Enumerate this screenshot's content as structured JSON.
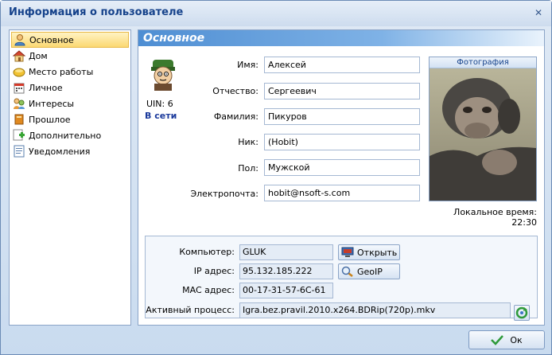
{
  "window": {
    "title": "Информация о пользователе",
    "close_glyph": "✕"
  },
  "sidebar": {
    "items": [
      {
        "label": "Основное",
        "icon": "user-icon",
        "active": true
      },
      {
        "label": "Дом",
        "icon": "home-icon"
      },
      {
        "label": "Место работы",
        "icon": "work-icon"
      },
      {
        "label": "Личное",
        "icon": "calendar-icon"
      },
      {
        "label": "Интересы",
        "icon": "interests-icon"
      },
      {
        "label": "Прошлое",
        "icon": "book-icon"
      },
      {
        "label": "Дополнительно",
        "icon": "plus-icon"
      },
      {
        "label": "Уведомления",
        "icon": "notes-icon"
      }
    ]
  },
  "main": {
    "header": "Основное",
    "uin_label": "UIN:",
    "uin_value": "6",
    "status": "В сети",
    "fields": [
      {
        "label": "Имя:",
        "value": "Алексей"
      },
      {
        "label": "Отчество:",
        "value": "Сергеевич"
      },
      {
        "label": "Фамилия:",
        "value": "Пикуров"
      },
      {
        "label": "Ник:",
        "value": "(Hobit)"
      },
      {
        "label": "Пол:",
        "value": "Мужской"
      },
      {
        "label": "Электропочта:",
        "value": "hobit@nsoft-s.com"
      }
    ],
    "photo_title": "Фотография",
    "local_time": "Локальное время: 22:30"
  },
  "network": {
    "computer_label": "Компьютер:",
    "computer_value": "GLUK",
    "open_button": "Открыть",
    "ip_label": "IP адрес:",
    "ip_value": "95.132.185.222",
    "geoip_button": "GeoIP",
    "mac_label": "MAC адрес:",
    "mac_value": "00-17-31-57-6C-61",
    "process_label": "Активный процесс:",
    "process_value": "Igra.bez.pravil.2010.x264.BDRip(720p).mkv"
  },
  "footer": {
    "ok_button": "Ок"
  },
  "colors": {
    "accent": "#15428b",
    "active_item": "#fbd872",
    "header": "#4e8ed3"
  }
}
